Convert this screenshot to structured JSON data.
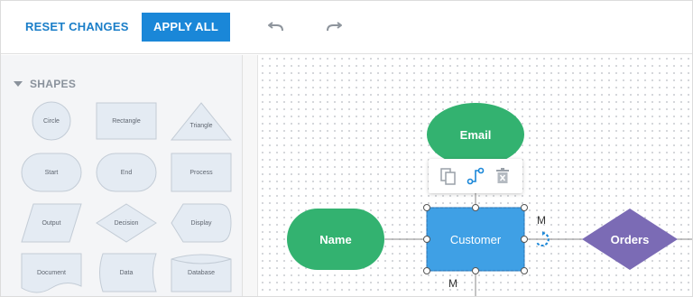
{
  "toolbar": {
    "reset_label": "RESET CHANGES",
    "apply_label": "APPLY ALL"
  },
  "sidebar": {
    "header": "SHAPES",
    "shapes": [
      {
        "label": "Circle"
      },
      {
        "label": "Rectangle"
      },
      {
        "label": "Triangle"
      },
      {
        "label": "Start"
      },
      {
        "label": "End"
      },
      {
        "label": "Process"
      },
      {
        "label": "Output"
      },
      {
        "label": "Decision"
      },
      {
        "label": "Display"
      },
      {
        "label": "Document"
      },
      {
        "label": "Data"
      },
      {
        "label": "Database"
      }
    ]
  },
  "diagram": {
    "nodes": {
      "email": "Email",
      "name": "Name",
      "customer": "Customer",
      "orders": "Orders"
    },
    "labels": {
      "m_right": "M",
      "m_bottom": "M"
    }
  },
  "colors": {
    "accent": "#1a87d8",
    "green_node": "#33b270",
    "selected_node": "#3fa0e5",
    "purple_node": "#7b6bb5"
  },
  "icons": [
    "undo-icon",
    "redo-icon",
    "copy-icon",
    "connector-icon",
    "delete-icon",
    "rotate-icon"
  ]
}
